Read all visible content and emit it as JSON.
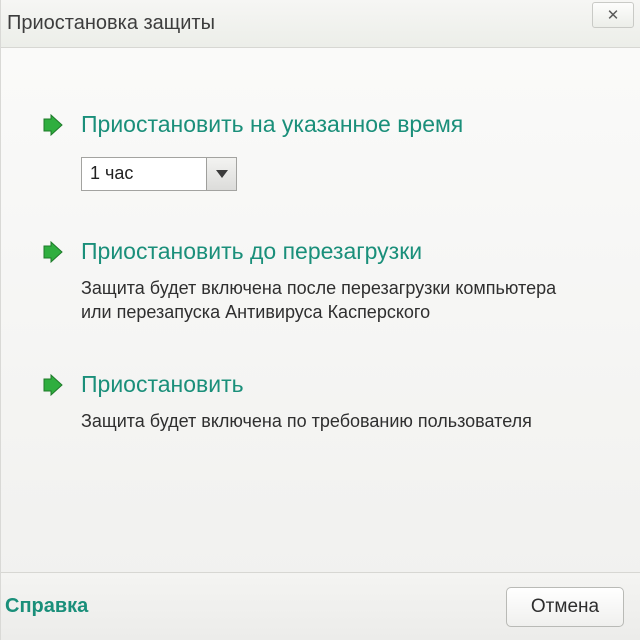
{
  "window": {
    "title": "Приостановка защиты"
  },
  "options": {
    "timed": {
      "heading": "Приостановить на указанное время",
      "selected": "1 час"
    },
    "until_restart": {
      "heading": "Приостановить до перезагрузки",
      "description": "Защита будет включена после перезагрузки компьютера или перезапуска Антивируса Касперского"
    },
    "manual": {
      "heading": "Приостановить",
      "description": "Защита будет включена по требованию пользователя"
    }
  },
  "footer": {
    "help": "Справка",
    "cancel": "Отмена"
  }
}
